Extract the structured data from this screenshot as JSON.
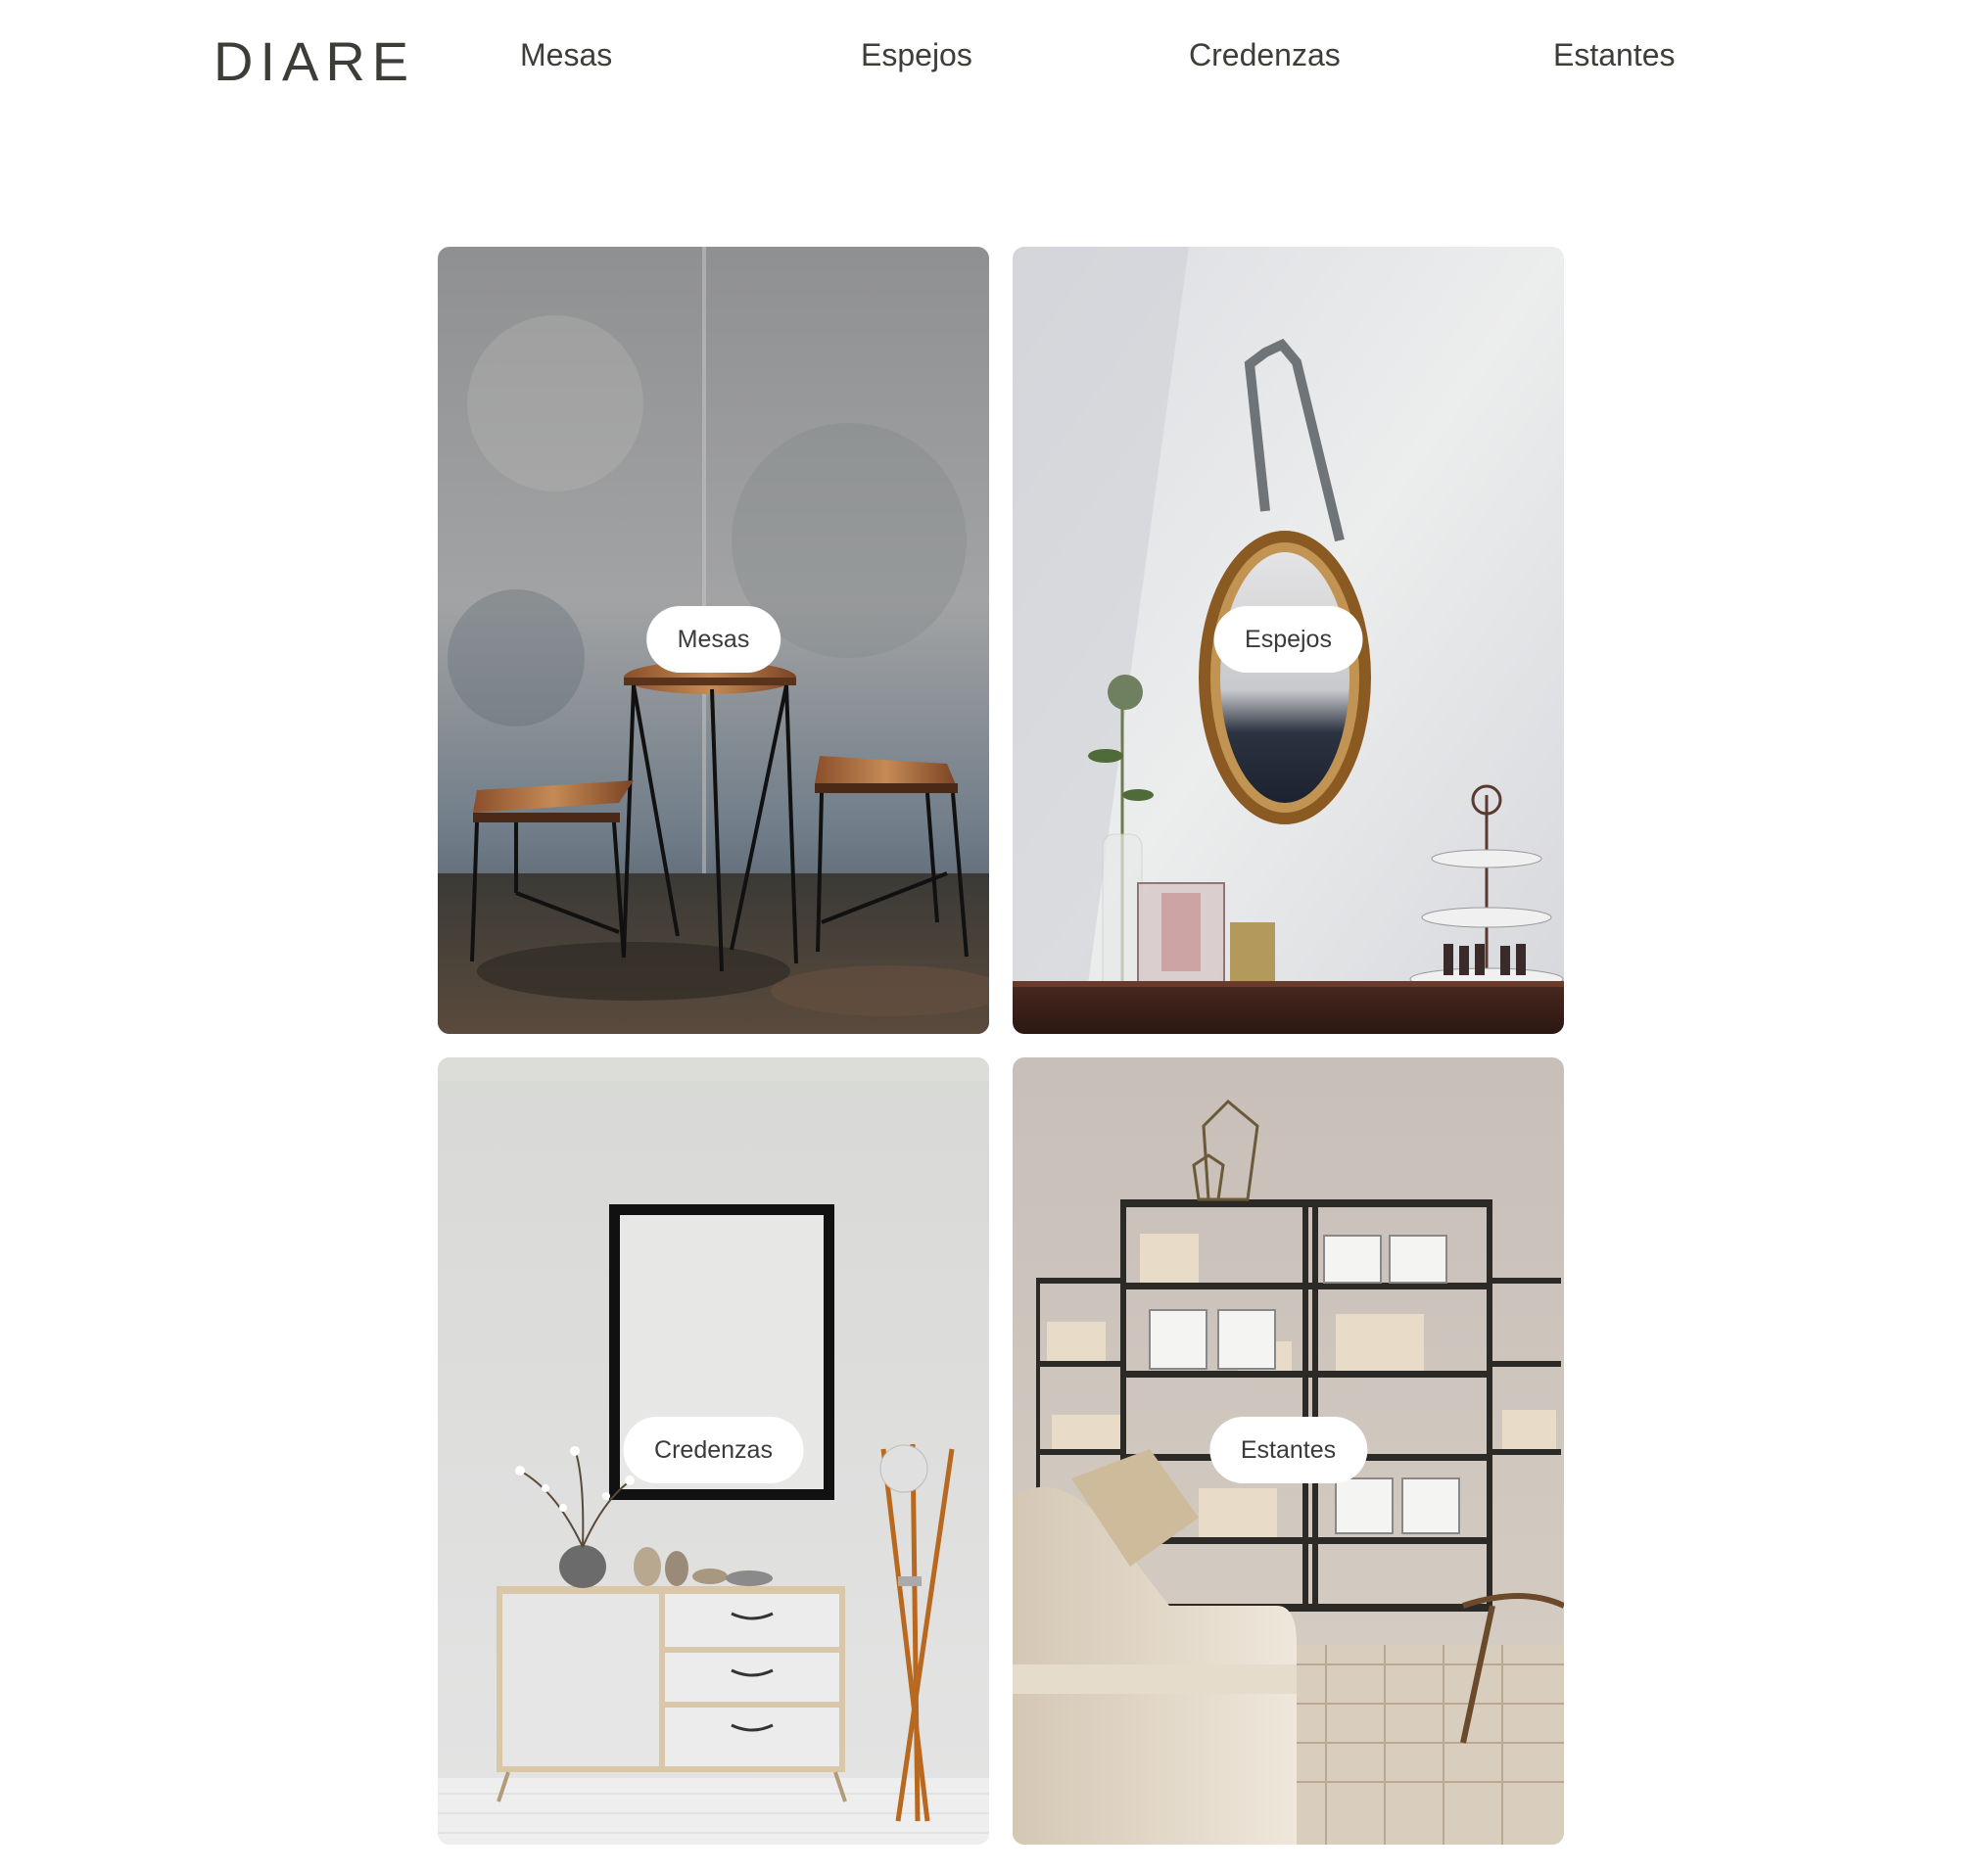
{
  "header": {
    "logo": "DIARE",
    "nav": [
      "Mesas",
      "Espejos",
      "Credenzas",
      "Estantes"
    ]
  },
  "categories": [
    {
      "label": "Mesas",
      "image": "table-and-stools-photo"
    },
    {
      "label": "Espejos",
      "image": "oval-mirror-photo"
    },
    {
      "label": "Credenzas",
      "image": "sideboard-photo"
    },
    {
      "label": "Estantes",
      "image": "bookshelf-livingroom-photo"
    }
  ]
}
